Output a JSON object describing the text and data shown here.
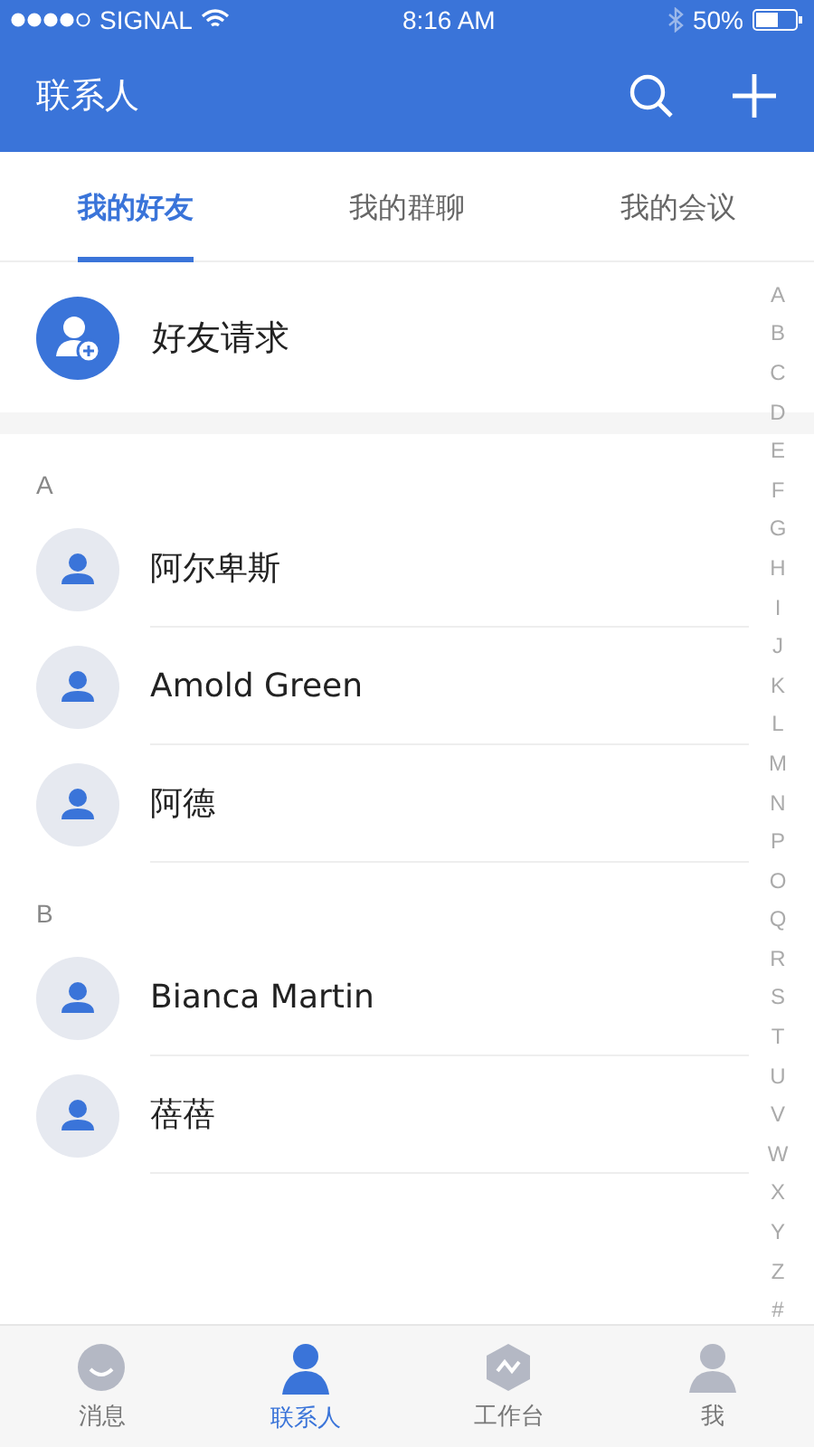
{
  "status_bar": {
    "carrier": "SIGNAL",
    "time": "8:16 AM",
    "battery": "50%"
  },
  "header": {
    "title": "联系人"
  },
  "tabs": [
    {
      "label": "我的好友",
      "selected": true
    },
    {
      "label": "我的群聊",
      "selected": false
    },
    {
      "label": "我的会议",
      "selected": false
    }
  ],
  "friend_request": {
    "label": "好友请求"
  },
  "sections": [
    {
      "letter": "A",
      "contacts": [
        {
          "name": "阿尔卑斯"
        },
        {
          "name": "Amold Green"
        },
        {
          "name": "阿德"
        }
      ]
    },
    {
      "letter": "B",
      "contacts": [
        {
          "name": "Bianca Martin"
        },
        {
          "name": "蓓蓓"
        }
      ]
    }
  ],
  "index": [
    "A",
    "B",
    "C",
    "D",
    "E",
    "F",
    "G",
    "H",
    "I",
    "J",
    "K",
    "L",
    "M",
    "N",
    "P",
    "O",
    "Q",
    "R",
    "S",
    "T",
    "U",
    "V",
    "W",
    "X",
    "Y",
    "Z",
    "#"
  ],
  "bottom_nav": [
    {
      "label": "消息",
      "kind": "chat",
      "selected": false
    },
    {
      "label": "联系人",
      "kind": "contacts",
      "selected": true
    },
    {
      "label": "工作台",
      "kind": "work",
      "selected": false
    },
    {
      "label": "我",
      "kind": "me",
      "selected": false
    }
  ]
}
